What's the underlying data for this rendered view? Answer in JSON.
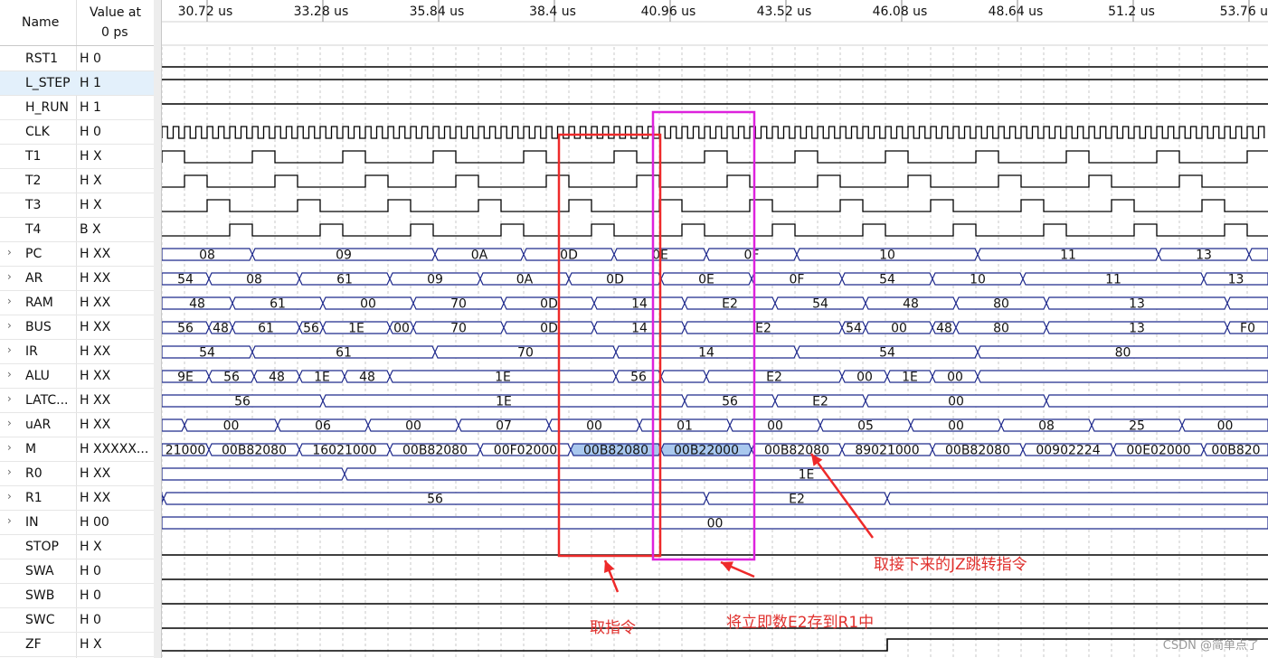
{
  "header": {
    "name": "Name",
    "value_line1": "Value at",
    "value_line2": "0 ps"
  },
  "time_ticks": [
    "30.72 us",
    "33.28 us",
    "35.84 us",
    "38.4 us",
    "40.96 us",
    "43.52 us",
    "46.08 us",
    "48.64 us",
    "51.2 us",
    "53.76 us"
  ],
  "signals": [
    {
      "name": "RST1",
      "value": "H 0",
      "kind": "line",
      "level": 0
    },
    {
      "name": "L_STEP",
      "value": "H 1",
      "kind": "line",
      "level": 1,
      "selected": true
    },
    {
      "name": "H_RUN",
      "value": "H 1",
      "kind": "line",
      "level": 1
    },
    {
      "name": "CLK",
      "value": "H 0",
      "kind": "clock"
    },
    {
      "name": "T1",
      "value": "H X",
      "kind": "pulse",
      "phase": 0
    },
    {
      "name": "T2",
      "value": "H X",
      "kind": "pulse",
      "phase": 1
    },
    {
      "name": "T3",
      "value": "H X",
      "kind": "pulse",
      "phase": 2
    },
    {
      "name": "T4",
      "value": "B X",
      "kind": "pulse",
      "phase": 3
    },
    {
      "name": "PC",
      "value": "H XX",
      "kind": "bus",
      "expandable": true,
      "segs": [
        [
          "08",
          0,
          100
        ],
        [
          "09",
          100,
          302
        ],
        [
          "0A",
          302,
          400
        ],
        [
          "0D",
          400,
          500
        ],
        [
          "0E",
          500,
          602
        ],
        [
          "0F",
          602,
          702
        ],
        [
          "10",
          702,
          902
        ],
        [
          "11",
          902,
          1102
        ],
        [
          "13",
          1102,
          1202
        ],
        [
          "",
          1202,
          1223
        ]
      ]
    },
    {
      "name": "AR",
      "value": "H XX",
      "kind": "bus",
      "expandable": true,
      "segs": [
        [
          "54",
          0,
          52
        ],
        [
          "08",
          52,
          152
        ],
        [
          "61",
          152,
          252
        ],
        [
          "09",
          252,
          352
        ],
        [
          "0A",
          352,
          450
        ],
        [
          "0D",
          450,
          552
        ],
        [
          "0E",
          552,
          652
        ],
        [
          "0F",
          652,
          752
        ],
        [
          "54",
          752,
          852
        ],
        [
          "10",
          852,
          952
        ],
        [
          "11",
          952,
          1152
        ],
        [
          "13",
          1152,
          1223
        ]
      ]
    },
    {
      "name": "RAM",
      "value": "H XX",
      "kind": "bus",
      "expandable": true,
      "segs": [
        [
          "48",
          0,
          78
        ],
        [
          "61",
          78,
          178
        ],
        [
          "00",
          178,
          278
        ],
        [
          "70",
          278,
          378
        ],
        [
          "0D",
          378,
          478
        ],
        [
          "14",
          478,
          578
        ],
        [
          "E2",
          578,
          678
        ],
        [
          "54",
          678,
          778
        ],
        [
          "48",
          778,
          878
        ],
        [
          "80",
          878,
          978
        ],
        [
          "13",
          978,
          1178
        ],
        [
          "",
          1178,
          1223
        ]
      ]
    },
    {
      "name": "BUS",
      "value": "H XX",
      "kind": "bus",
      "expandable": true,
      "segs": [
        [
          "56",
          0,
          52
        ],
        [
          "48",
          52,
          78
        ],
        [
          "61",
          78,
          152
        ],
        [
          "56",
          152,
          178
        ],
        [
          "1E",
          178,
          252
        ],
        [
          "00",
          252,
          278
        ],
        [
          "70",
          278,
          378
        ],
        [
          "0D",
          378,
          478
        ],
        [
          "14",
          478,
          578
        ],
        [
          "E2",
          578,
          752
        ],
        [
          "54",
          752,
          778
        ],
        [
          "00",
          778,
          852
        ],
        [
          "48",
          852,
          878
        ],
        [
          "80",
          878,
          978
        ],
        [
          "13",
          978,
          1178
        ],
        [
          "F0",
          1178,
          1223
        ]
      ]
    },
    {
      "name": "IR",
      "value": "H XX",
      "kind": "bus",
      "expandable": true,
      "segs": [
        [
          "54",
          0,
          100
        ],
        [
          "61",
          100,
          302
        ],
        [
          "70",
          302,
          502
        ],
        [
          "14",
          502,
          702
        ],
        [
          "54",
          702,
          902
        ],
        [
          "80",
          902,
          1223
        ]
      ]
    },
    {
      "name": "ALU",
      "value": "H XX",
      "kind": "bus",
      "expandable": true,
      "segs": [
        [
          "9E",
          0,
          52
        ],
        [
          "56",
          52,
          102
        ],
        [
          "48",
          102,
          152
        ],
        [
          "1E",
          152,
          202
        ],
        [
          "48",
          202,
          252
        ],
        [
          "1E",
          252,
          502
        ],
        [
          "56",
          502,
          552
        ],
        [
          "",
          552,
          602
        ],
        [
          "E2",
          602,
          752
        ],
        [
          "00",
          752,
          802
        ],
        [
          "1E",
          802,
          852
        ],
        [
          "00",
          852,
          902
        ],
        [
          "",
          902,
          1223
        ]
      ]
    },
    {
      "name": "LATC...",
      "value": "H XX",
      "kind": "bus",
      "expandable": true,
      "segs": [
        [
          "56",
          0,
          178
        ],
        [
          "1E",
          178,
          578
        ],
        [
          "56",
          578,
          678
        ],
        [
          "E2",
          678,
          778
        ],
        [
          "00",
          778,
          978
        ],
        [
          "",
          978,
          1223
        ]
      ]
    },
    {
      "name": "uAR",
      "value": "H XX",
      "kind": "bus",
      "expandable": true,
      "segs": [
        [
          "",
          0,
          25
        ],
        [
          "00",
          25,
          128
        ],
        [
          "06",
          128,
          228
        ],
        [
          "00",
          228,
          328
        ],
        [
          "07",
          328,
          428
        ],
        [
          "00",
          428,
          528
        ],
        [
          "01",
          528,
          628
        ],
        [
          "00",
          628,
          728
        ],
        [
          "05",
          728,
          828
        ],
        [
          "00",
          828,
          928
        ],
        [
          "08",
          928,
          1028
        ],
        [
          "25",
          1028,
          1128
        ],
        [
          "00",
          1128,
          1223
        ]
      ]
    },
    {
      "name": "M",
      "value": "H XXXXX...",
      "kind": "bus",
      "expandable": true,
      "segs": [
        [
          "21000",
          0,
          52
        ],
        [
          "00B82080",
          52,
          152
        ],
        [
          "16021000",
          152,
          252
        ],
        [
          "00B82080",
          252,
          352
        ],
        [
          "00F02000",
          352,
          452
        ],
        [
          "00B82080",
          452,
          552,
          true
        ],
        [
          "00B22000",
          552,
          652,
          true
        ],
        [
          "00B82080",
          652,
          752
        ],
        [
          "89021000",
          752,
          852
        ],
        [
          "00B82080",
          852,
          952
        ],
        [
          "00902224",
          952,
          1052
        ],
        [
          "00E02000",
          1052,
          1152
        ],
        [
          "00B820",
          1152,
          1223
        ]
      ]
    },
    {
      "name": "R0",
      "value": "H XX",
      "kind": "bus",
      "expandable": true,
      "segs": [
        [
          "",
          0,
          202
        ],
        [
          "1E",
          202,
          1223
        ]
      ]
    },
    {
      "name": "R1",
      "value": "H XX",
      "kind": "bus",
      "expandable": true,
      "segs": [
        [
          "",
          0,
          2
        ],
        [
          "56",
          2,
          602
        ],
        [
          "E2",
          602,
          802
        ],
        [
          "",
          802,
          1223
        ]
      ]
    },
    {
      "name": "IN",
      "value": "H 00",
      "kind": "bus",
      "expandable": true,
      "segs": [
        [
          "00",
          0,
          1223
        ]
      ]
    },
    {
      "name": "STOP",
      "value": "H X",
      "kind": "line",
      "level": 0
    },
    {
      "name": "SWA",
      "value": "H 0",
      "kind": "line",
      "level": 0
    },
    {
      "name": "SWB",
      "value": "H 0",
      "kind": "line",
      "level": 0
    },
    {
      "name": "SWC",
      "value": "H 0",
      "kind": "line",
      "level": 0
    },
    {
      "name": "ZF",
      "value": "H X",
      "kind": "step",
      "rise": 802
    }
  ],
  "annotations": {
    "fetch": "取指令",
    "store": "将立即数E2存到R1中",
    "jz": "取接下来的JZ跳转指令"
  },
  "watermark": "CSDN @简单点了",
  "colors": {
    "bus": "#1f2a8c",
    "line": "#000000",
    "highlight": "#a9c8ee",
    "red": "#ee2a2a",
    "magenta": "#dd22dd",
    "grid": "#bdbdbd"
  }
}
